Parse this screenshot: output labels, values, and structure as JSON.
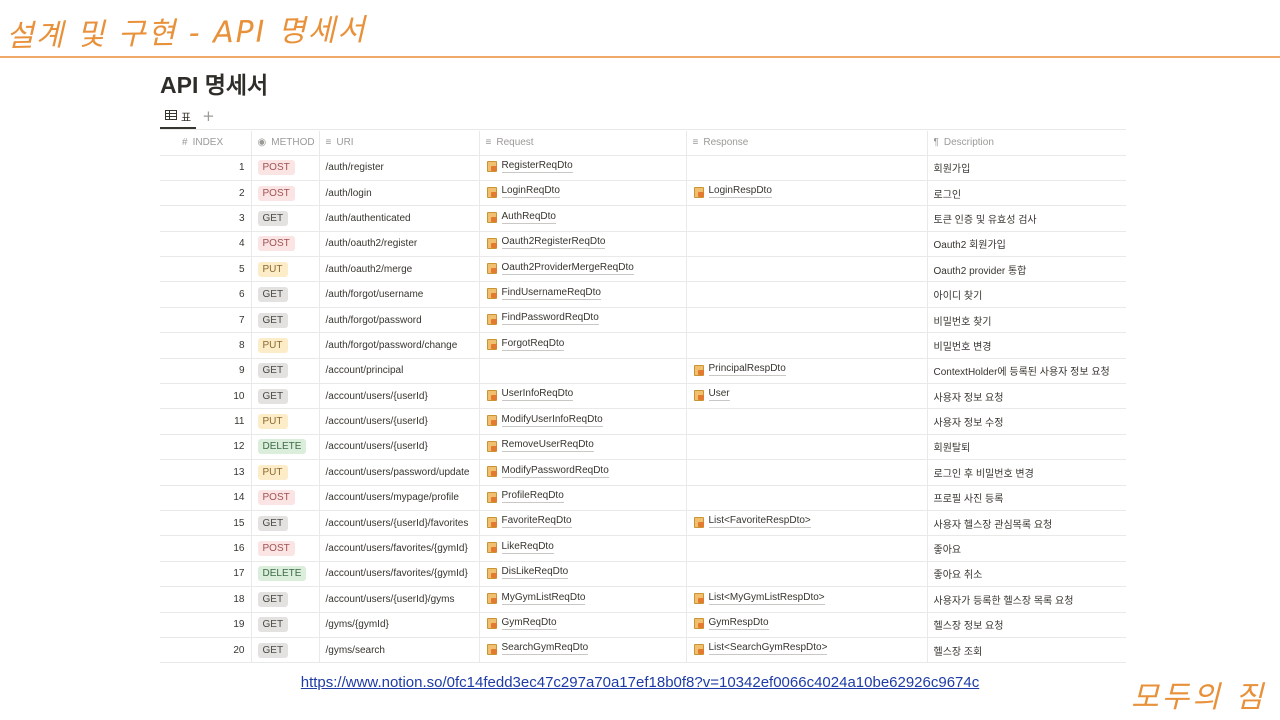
{
  "slide_title": "설계 및 구현 - API 명세서",
  "doc_title": "API 명세서",
  "view_tab_label": "표",
  "view_add": "+",
  "columns": {
    "index": "INDEX",
    "method": "METHOD",
    "uri": "URI",
    "request": "Request",
    "response": "Response",
    "description": "Description"
  },
  "rows": [
    {
      "index": "1",
      "method": "POST",
      "uri": "/auth/register",
      "request": "RegisterReqDto",
      "response": "",
      "description": "회원가입"
    },
    {
      "index": "2",
      "method": "POST",
      "uri": "/auth/login",
      "request": "LoginReqDto",
      "response": "LoginRespDto",
      "description": "로그인"
    },
    {
      "index": "3",
      "method": "GET",
      "uri": "/auth/authenticated",
      "request": "AuthReqDto",
      "response": "",
      "description": "토큰 인증 및 유효성 검사"
    },
    {
      "index": "4",
      "method": "POST",
      "uri": "/auth/oauth2/register",
      "request": "Oauth2RegisterReqDto",
      "response": "",
      "description": "Oauth2 회원가입"
    },
    {
      "index": "5",
      "method": "PUT",
      "uri": "/auth/oauth2/merge",
      "request": "Oauth2ProviderMergeReqDto",
      "response": "",
      "description": "Oauth2 provider 통합"
    },
    {
      "index": "6",
      "method": "GET",
      "uri": "/auth/forgot/username",
      "request": "FindUsernameReqDto",
      "response": "",
      "description": "아이디 찾기"
    },
    {
      "index": "7",
      "method": "GET",
      "uri": "/auth/forgot/password",
      "request": "FindPasswordReqDto",
      "response": "",
      "description": "비밀번호 찾기"
    },
    {
      "index": "8",
      "method": "PUT",
      "uri": "/auth/forgot/password/change",
      "request": "ForgotReqDto",
      "response": "",
      "description": "비밀번호 변경"
    },
    {
      "index": "9",
      "method": "GET",
      "uri": "/account/principal",
      "request": "",
      "response": "PrincipalRespDto",
      "description": "ContextHolder에 등록된 사용자 정보 요청"
    },
    {
      "index": "10",
      "method": "GET",
      "uri": "/account/users/{userId}",
      "request": "UserInfoReqDto",
      "response": "User",
      "description": "사용자 정보 요청"
    },
    {
      "index": "11",
      "method": "PUT",
      "uri": "/account/users/{userId}",
      "request": "ModifyUserInfoReqDto",
      "response": "",
      "description": "사용자 정보 수정"
    },
    {
      "index": "12",
      "method": "DELETE",
      "uri": "/account/users/{userId}",
      "request": "RemoveUserReqDto",
      "response": "",
      "description": "회원탈퇴"
    },
    {
      "index": "13",
      "method": "PUT",
      "uri": "/account/users/password/update",
      "request": "ModifyPasswordReqDto",
      "response": "",
      "description": "로그인 후 비밀번호 변경"
    },
    {
      "index": "14",
      "method": "POST",
      "uri": "/account/users/mypage/profile",
      "request": "ProfileReqDto",
      "response": "",
      "description": "프로필 사진 등록"
    },
    {
      "index": "15",
      "method": "GET",
      "uri": "/account/users/{userId}/favorites",
      "request": "FavoriteReqDto",
      "response": "List<FavoriteRespDto>",
      "description": "사용자 헬스장 관심목록 요청"
    },
    {
      "index": "16",
      "method": "POST",
      "uri": "/account/users/favorites/{gymId}",
      "request": "LikeReqDto",
      "response": "",
      "description": "좋아요"
    },
    {
      "index": "17",
      "method": "DELETE",
      "uri": "/account/users/favorites/{gymId}",
      "request": "DisLikeReqDto",
      "response": "",
      "description": "좋아요 취소"
    },
    {
      "index": "18",
      "method": "GET",
      "uri": "/account/users/{userId}/gyms",
      "request": "MyGymListReqDto",
      "response": "List<MyGymListRespDto>",
      "description": "사용자가 등록한 헬스장 목록 요청"
    },
    {
      "index": "19",
      "method": "GET",
      "uri": "/gyms/{gymId}",
      "request": "GymReqDto",
      "response": "GymRespDto",
      "description": "헬스장 정보 요청"
    },
    {
      "index": "20",
      "method": "GET",
      "uri": "/gyms/search",
      "request": "SearchGymReqDto",
      "response": "List<SearchGymRespDto>",
      "description": "헬스장 조회"
    }
  ],
  "link_text": "https://www.notion.so/0fc14fedd3ec47c297a70a17ef18b0f8?v=10342ef0066c4024a10be62926c9674c",
  "brand": "모두의 짐"
}
